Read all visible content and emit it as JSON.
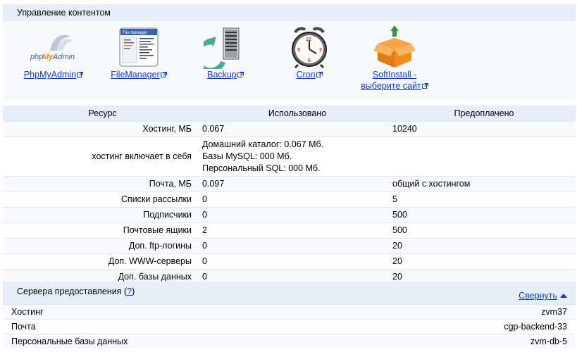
{
  "content": {
    "title": "Управление контентом",
    "tools": [
      {
        "label": "PhpMyAdmin",
        "icon": "phpmyadmin-logo-icon"
      },
      {
        "label": "FileManager",
        "icon": "file-manager-icon"
      },
      {
        "label": "Backup",
        "icon": "backup-server-icon"
      },
      {
        "label": "Cron",
        "icon": "alarm-clock-icon"
      },
      {
        "label_line1": "SoftInstall -",
        "label_line2": "выберите сайт",
        "icon": "box-install-icon"
      }
    ],
    "phpmyadmin_logo_php": "php",
    "phpmyadmin_logo_my": "My",
    "phpmyadmin_logo_admin": "Admin",
    "filemanager_logo_text": "File manager"
  },
  "resources": {
    "headers": [
      "Ресурс",
      "Использовано",
      "Предоплачено"
    ],
    "rows": [
      {
        "name": "Хостинг, МБ",
        "used": "0.067",
        "prepaid": "10240"
      },
      {
        "name": "хостинг включает в себя",
        "used_lines": [
          "Домашний каталог: 0.067 Мб.",
          "Базы MySQL: 000 Мб.",
          "Персональный SQL: 000 Мб."
        ],
        "prepaid": ""
      },
      {
        "name": "Почта, МБ",
        "used": "0.097",
        "prepaid": "общий с хостингом"
      },
      {
        "name": "Списки рассылки",
        "used": "0",
        "prepaid": "5"
      },
      {
        "name": "Подписчики",
        "used": "0",
        "prepaid": "500"
      },
      {
        "name": "Почтовые ящики",
        "used": "2",
        "prepaid": "500"
      },
      {
        "name": "Доп. ftp-логины",
        "used": "0",
        "prepaid": "20"
      },
      {
        "name": "Доп. WWW-серверы",
        "used": "0",
        "prepaid": "20"
      },
      {
        "name": "Доп. базы данных",
        "used": "0",
        "prepaid": "20"
      }
    ]
  },
  "servers": {
    "title": "Сервера предоставления",
    "help": "?",
    "paren_open": "(",
    "paren_close": ")",
    "collapse_label": "Свернуть",
    "rows": [
      {
        "name": "Хостинг",
        "value": "zvm37"
      },
      {
        "name": "Почта",
        "value": "cgp-backend-33"
      },
      {
        "name": "Персональные базы данных",
        "value": "zvm-db-5"
      }
    ]
  },
  "colors": {
    "link": "#0c3ec4",
    "header_bg": "#e8eef8",
    "panel_bg": "#f7f9fd",
    "phpmyadmin_blue": "#3a5da8",
    "phpmyadmin_orange": "#f29000",
    "backup_green": "#4dab8a",
    "box_orange": "#f08a1e"
  }
}
